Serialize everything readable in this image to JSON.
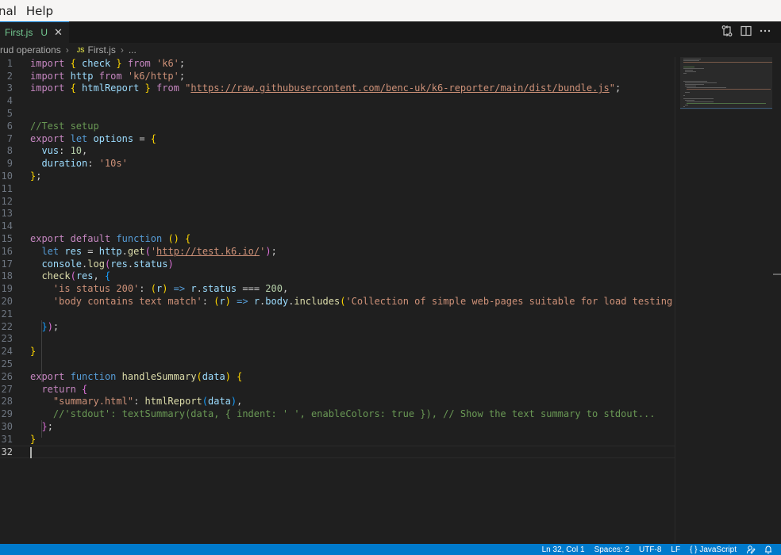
{
  "menubar": {
    "items": [
      "nal",
      "Help"
    ]
  },
  "tabs": [
    {
      "label": "First.js",
      "status": "U",
      "close": "✕"
    }
  ],
  "breadcrumb": {
    "folder": "rud operations",
    "file_icon": "JS",
    "file": "First.js",
    "more": "..."
  },
  "editor": {
    "current_line": 32,
    "lines": [
      {
        "n": "1"
      },
      {
        "n": "2"
      },
      {
        "n": "3"
      },
      {
        "n": "4"
      },
      {
        "n": "5"
      },
      {
        "n": "6"
      },
      {
        "n": "7"
      },
      {
        "n": "8"
      },
      {
        "n": "9"
      },
      {
        "n": "10"
      },
      {
        "n": "11"
      },
      {
        "n": "12"
      },
      {
        "n": "13"
      },
      {
        "n": "14"
      },
      {
        "n": "15"
      },
      {
        "n": "16"
      },
      {
        "n": "17"
      },
      {
        "n": "18"
      },
      {
        "n": "19"
      },
      {
        "n": "20"
      },
      {
        "n": "21"
      },
      {
        "n": "22"
      },
      {
        "n": "23"
      },
      {
        "n": "24"
      },
      {
        "n": "25"
      },
      {
        "n": "26"
      },
      {
        "n": "27"
      },
      {
        "n": "28"
      },
      {
        "n": "29"
      },
      {
        "n": "30"
      },
      {
        "n": "31"
      },
      {
        "n": "32"
      }
    ],
    "tokens": {
      "l1": [
        "import",
        " ",
        "{",
        " check ",
        "}",
        " from ",
        "'k6'",
        ";"
      ],
      "l2": [
        "import",
        " http ",
        "from",
        " ",
        "'k6/http'",
        ";"
      ],
      "l3": [
        "import",
        " ",
        "{",
        " htmlReport ",
        "}",
        " from ",
        "\"",
        "https://raw.githubusercontent.com/benc-uk/k6-reporter/main/dist/bundle.js",
        "\"",
        ";"
      ],
      "l6": [
        "//Test setup"
      ],
      "l7": [
        "export",
        " ",
        "let",
        " ",
        "options",
        " = ",
        "{"
      ],
      "l8": [
        "  vus",
        ": ",
        "10",
        ","
      ],
      "l9": [
        "  duration",
        ": ",
        "'10s'"
      ],
      "l10": [
        "}",
        ";"
      ],
      "l15": [
        "export",
        " ",
        "default",
        " ",
        "function",
        " ",
        "()",
        " ",
        "{"
      ],
      "l16": [
        "  ",
        "let",
        " ",
        "res",
        " = ",
        "http",
        ".",
        "get",
        "(",
        "'",
        "http://test.k6.io/",
        "'",
        ")",
        ";"
      ],
      "l17": [
        "  ",
        "console",
        ".",
        "log",
        "(",
        "res",
        ".",
        "status",
        ")"
      ],
      "l18": [
        "  ",
        "check",
        "(",
        "res",
        ", ",
        "{"
      ],
      "l19": [
        "    ",
        "'is status 200'",
        ": ",
        "(",
        "r",
        ")",
        " => ",
        "r",
        ".",
        "status",
        " === ",
        "200",
        ","
      ],
      "l20": [
        "    ",
        "'body contains text match'",
        ": ",
        "(",
        "r",
        ")",
        " => ",
        "r",
        ".",
        "body",
        ".",
        "includes",
        "(",
        "'Collection of simple web-pages suitable for load testing.'",
        ")",
        ","
      ],
      "l22": [
        "  ",
        "}",
        ")",
        ";"
      ],
      "l24": [
        "}"
      ],
      "l26": [
        "export",
        " ",
        "function",
        " ",
        "handleSummary",
        "(",
        "data",
        ")",
        " ",
        "{"
      ],
      "l27": [
        "  ",
        "return",
        " ",
        "{"
      ],
      "l28": [
        "    ",
        "\"summary.html\"",
        ": ",
        "htmlReport",
        "(",
        "data",
        ")",
        ","
      ],
      "l29": [
        "    ",
        "//'stdout': textSummary(data, { indent: ' ', enableColors: true }), // Show the text summary to stdout..."
      ],
      "l30": [
        "  ",
        "}",
        ";"
      ],
      "l31": [
        "}"
      ]
    }
  },
  "statusbar": {
    "position": "Ln 32, Col 1",
    "spaces": "Spaces: 2",
    "encoding": "UTF-8",
    "eol": "LF",
    "language_braces": "{ }",
    "language": "JavaScript"
  },
  "colors": {
    "accent": "#007acc",
    "editor_bg": "#1f1f1f",
    "tab_modified": "#73c991"
  }
}
